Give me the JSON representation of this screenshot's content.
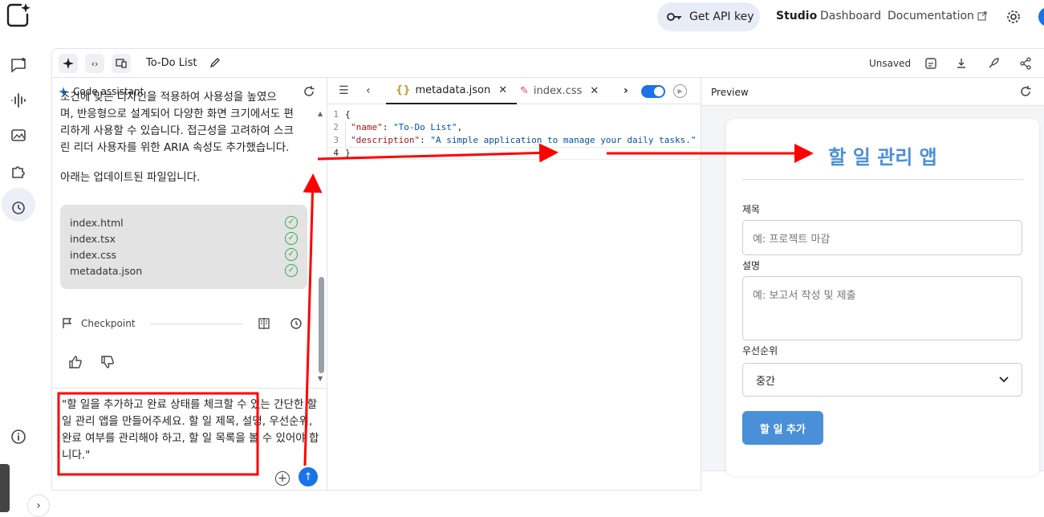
{
  "header": {
    "api_key_label": "Get API key",
    "nav": {
      "studio": "Studio",
      "dashboard": "Dashboard",
      "documentation": "Documentation"
    }
  },
  "toolbar": {
    "app_title": "To-Do List",
    "status": "Unsaved"
  },
  "assistant": {
    "title": "Code assistant",
    "paragraph_1_line_1": "조건에 맞는 디자인을 적용하여 사용성을 높였으",
    "paragraph_1_line_2": "며, 반응형으로 설계되어 다양한 화면 크기에서도 편",
    "paragraph_1_line_3": "리하게 사용할 수 있습니다. 접근성을 고려하여 스크",
    "paragraph_1_line_4": "린 리더 사용자를 위한 ARIA 속성도 추가했습니다.",
    "paragraph_2": "아래는 업데이트된 파일입니다.",
    "files": [
      "index.html",
      "index.tsx",
      "index.css",
      "metadata.json"
    ],
    "checkpoint_label": "Checkpoint",
    "prompt": "\"할 일을 추가하고 완료 상태를 체크할 수 있는 간단한 할 일 관리 앱을 만들어주세요. 할 일 제목, 설명, 우선순위, 완료 여부를 관리해야 하고, 할 일 목록을 볼 수 있어야 합니다.\""
  },
  "editor": {
    "tabs": [
      {
        "label": "metadata.json",
        "active": true
      },
      {
        "label": "index.css",
        "active": false
      }
    ],
    "lines": [
      {
        "num": "1",
        "open": "{"
      },
      {
        "num": "2",
        "key": "\"name\"",
        "sep": ": ",
        "value": "\"To-Do List\"",
        "end": ","
      },
      {
        "num": "3",
        "key": "\"description\"",
        "sep": ": ",
        "value": "\"A simple application to manage your daily tasks.\"",
        "end": ""
      },
      {
        "num": "4",
        "close": "}"
      }
    ]
  },
  "preview": {
    "title": "Preview",
    "app_heading": "할 일 관리 앱",
    "fields": {
      "title_label": "제목",
      "title_placeholder": "예: 프로젝트 마감",
      "desc_label": "설명",
      "desc_placeholder": "예: 보고서 작성 및 제출",
      "priority_label": "우선순위",
      "priority_value": "중간"
    },
    "add_button": "할 일 추가"
  },
  "colors": {
    "accent": "#1a73e8",
    "app_blue": "#4a90d9",
    "annotation_red": "#ff0000",
    "check_green": "#34a853"
  }
}
